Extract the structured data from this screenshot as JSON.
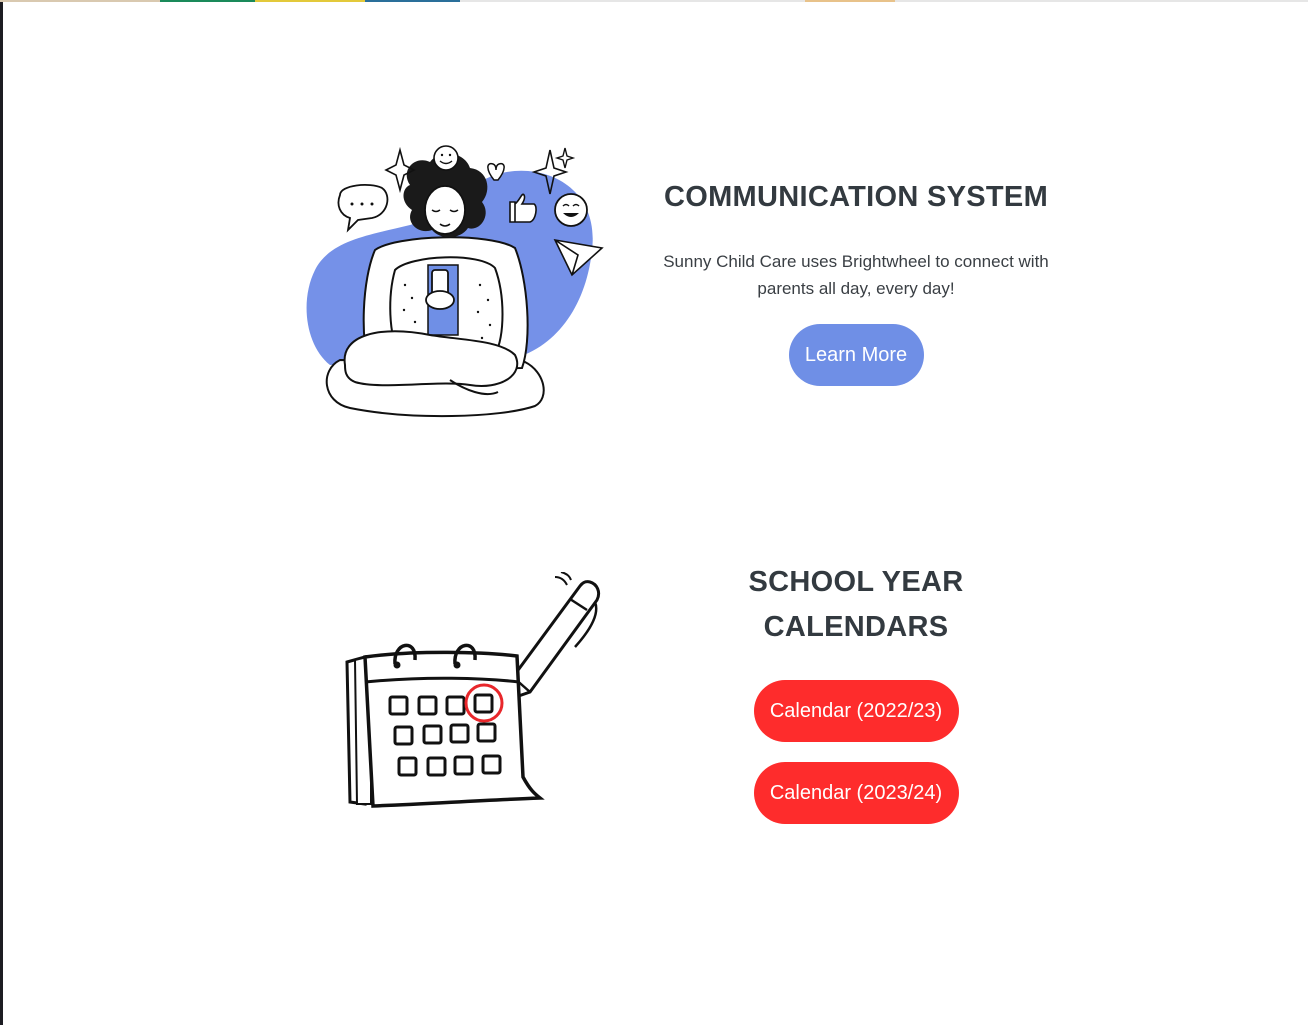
{
  "communication": {
    "title": "COMMUNICATION SYSTEM",
    "description_line1": "Sunny Child Care uses Brightwheel to connect with",
    "description_line2": "parents all day, every day!",
    "button_label": "Learn More",
    "illustration_icon": "woman-with-phone-illustration",
    "accent_color": "#6f8fe6"
  },
  "calendars": {
    "title_line1": "SCHOOL YEAR",
    "title_line2": "CALENDARS",
    "buttons": [
      {
        "label": "Calendar (2022/23)"
      },
      {
        "label": "Calendar (2023/24)"
      }
    ],
    "illustration_icon": "calendar-with-pen-illustration",
    "accent_color": "#fe2c2c"
  },
  "colors": {
    "heading": "#333a40",
    "background": "#ffffff"
  }
}
